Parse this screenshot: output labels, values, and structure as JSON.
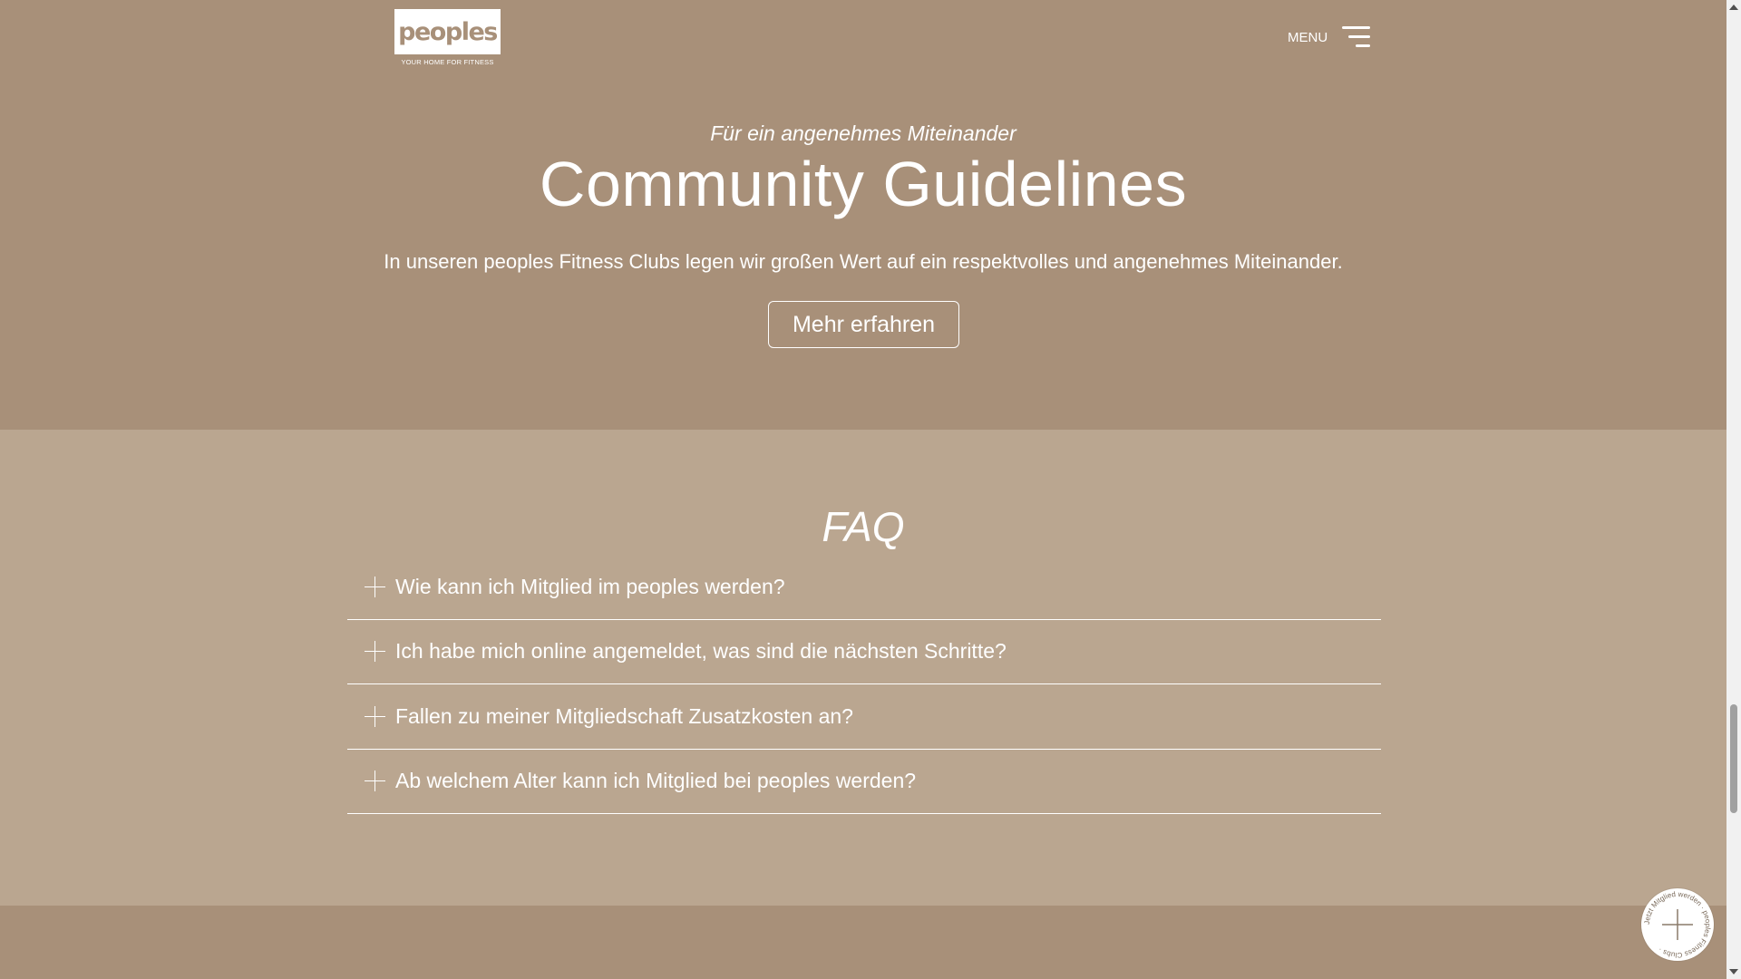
{
  "header": {
    "logo_text": "peoples",
    "logo_tagline": "YOUR HOME FOR FITNESS",
    "menu_label": "MENU"
  },
  "hero": {
    "subtitle": "Für ein angenehmes Miteinander",
    "title": "Community Guidelines",
    "text": "In unseren peoples Fitness Clubs legen wir großen Wert auf ein respektvolles und angenehmes Miteinander.",
    "button_label": "Mehr erfahren"
  },
  "faq": {
    "title": "FAQ",
    "items": [
      {
        "question": "Wie kann ich Mitglied im peoples werden?"
      },
      {
        "question": "Ich habe mich online angemeldet, was sind die nächsten Schritte?"
      },
      {
        "question": "Fallen zu meiner Mitgliedschaft Zusatzkosten an?"
      },
      {
        "question": "Ab welchem Alter kann ich Mitglied bei peoples werden?"
      }
    ]
  },
  "badge": {
    "ring_text": "Jetzt Mitglied werden · peoples Fitness Clubs ·",
    "icon": "plus-icon"
  },
  "colors": {
    "hero_bg": "#a89079",
    "faq_bg": "#baa690",
    "text": "#ffffff"
  }
}
